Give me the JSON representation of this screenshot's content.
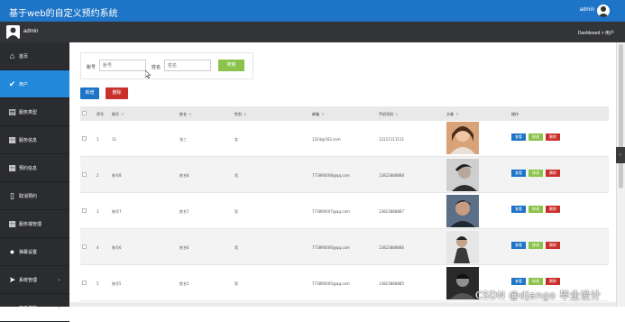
{
  "app": {
    "title": "基于web的自定义预约系统",
    "user": "admin"
  },
  "subbar": {
    "name": "admin",
    "breadcrumb": "Dashboard > 用户"
  },
  "sidebar": {
    "items": [
      {
        "label": "首页",
        "icon": "home-icon",
        "glyph": "⌂",
        "active": false
      },
      {
        "label": "用户",
        "icon": "check-icon",
        "glyph": "✔",
        "active": true
      },
      {
        "label": "服务类型",
        "icon": "list-icon",
        "glyph": "▤",
        "active": false
      },
      {
        "label": "服务信息",
        "icon": "grid-icon",
        "glyph": "▦",
        "active": false
      },
      {
        "label": "预约信息",
        "icon": "grid-icon",
        "glyph": "▦",
        "active": false
      },
      {
        "label": "取消预约",
        "icon": "file-icon",
        "glyph": "▯",
        "active": false
      },
      {
        "label": "服务端管理",
        "icon": "grid-icon",
        "glyph": "▦",
        "active": false
      },
      {
        "label": "弹幕设置",
        "icon": "user-icon",
        "glyph": "●",
        "active": false
      },
      {
        "label": "系统管理",
        "icon": "send-icon",
        "glyph": "➤",
        "active": false,
        "caret": "⌄"
      },
      {
        "label": "用户资料",
        "icon": "doc-icon",
        "glyph": "▭",
        "active": false,
        "caret": "⌄"
      }
    ]
  },
  "search": {
    "account_label": "账号",
    "account_placeholder": "账号",
    "name_label": "姓名",
    "name_placeholder": "姓名",
    "search_button": "搜索"
  },
  "toolbar": {
    "add": "新增",
    "delete": "删除"
  },
  "table": {
    "headers": [
      "序号",
      "账号",
      "姓名",
      "性别",
      "邮箱",
      "手机号码",
      "头像",
      "操作"
    ],
    "rows": [
      {
        "no": "1",
        "account": "11",
        "name": "张三",
        "gender": "女",
        "email": "1314@163.com",
        "phone": "13111111111"
      },
      {
        "no": "2",
        "account": "账号8",
        "name": "姓名8",
        "gender": "男",
        "email": "773890008@qq.com",
        "phone": "13823888888"
      },
      {
        "no": "3",
        "account": "账号7",
        "name": "姓名7",
        "gender": "男",
        "email": "773890007@qq.com",
        "phone": "13823888887"
      },
      {
        "no": "4",
        "account": "账号6",
        "name": "姓名6",
        "gender": "男",
        "email": "773890006@qq.com",
        "phone": "13823888886"
      },
      {
        "no": "5",
        "account": "账号5",
        "name": "姓名5",
        "gender": "男",
        "email": "773890005@qq.com",
        "phone": "13823888885"
      }
    ],
    "actions": {
      "view": "查看",
      "edit": "修改",
      "delete": "删除"
    }
  },
  "watermark": "CSDN @django  毕业设计",
  "colors": {
    "topbar": "#1e74c6",
    "sidebar": "#2b2c30",
    "active": "#2388da",
    "green": "#8bc34a",
    "red": "#c9302c"
  }
}
